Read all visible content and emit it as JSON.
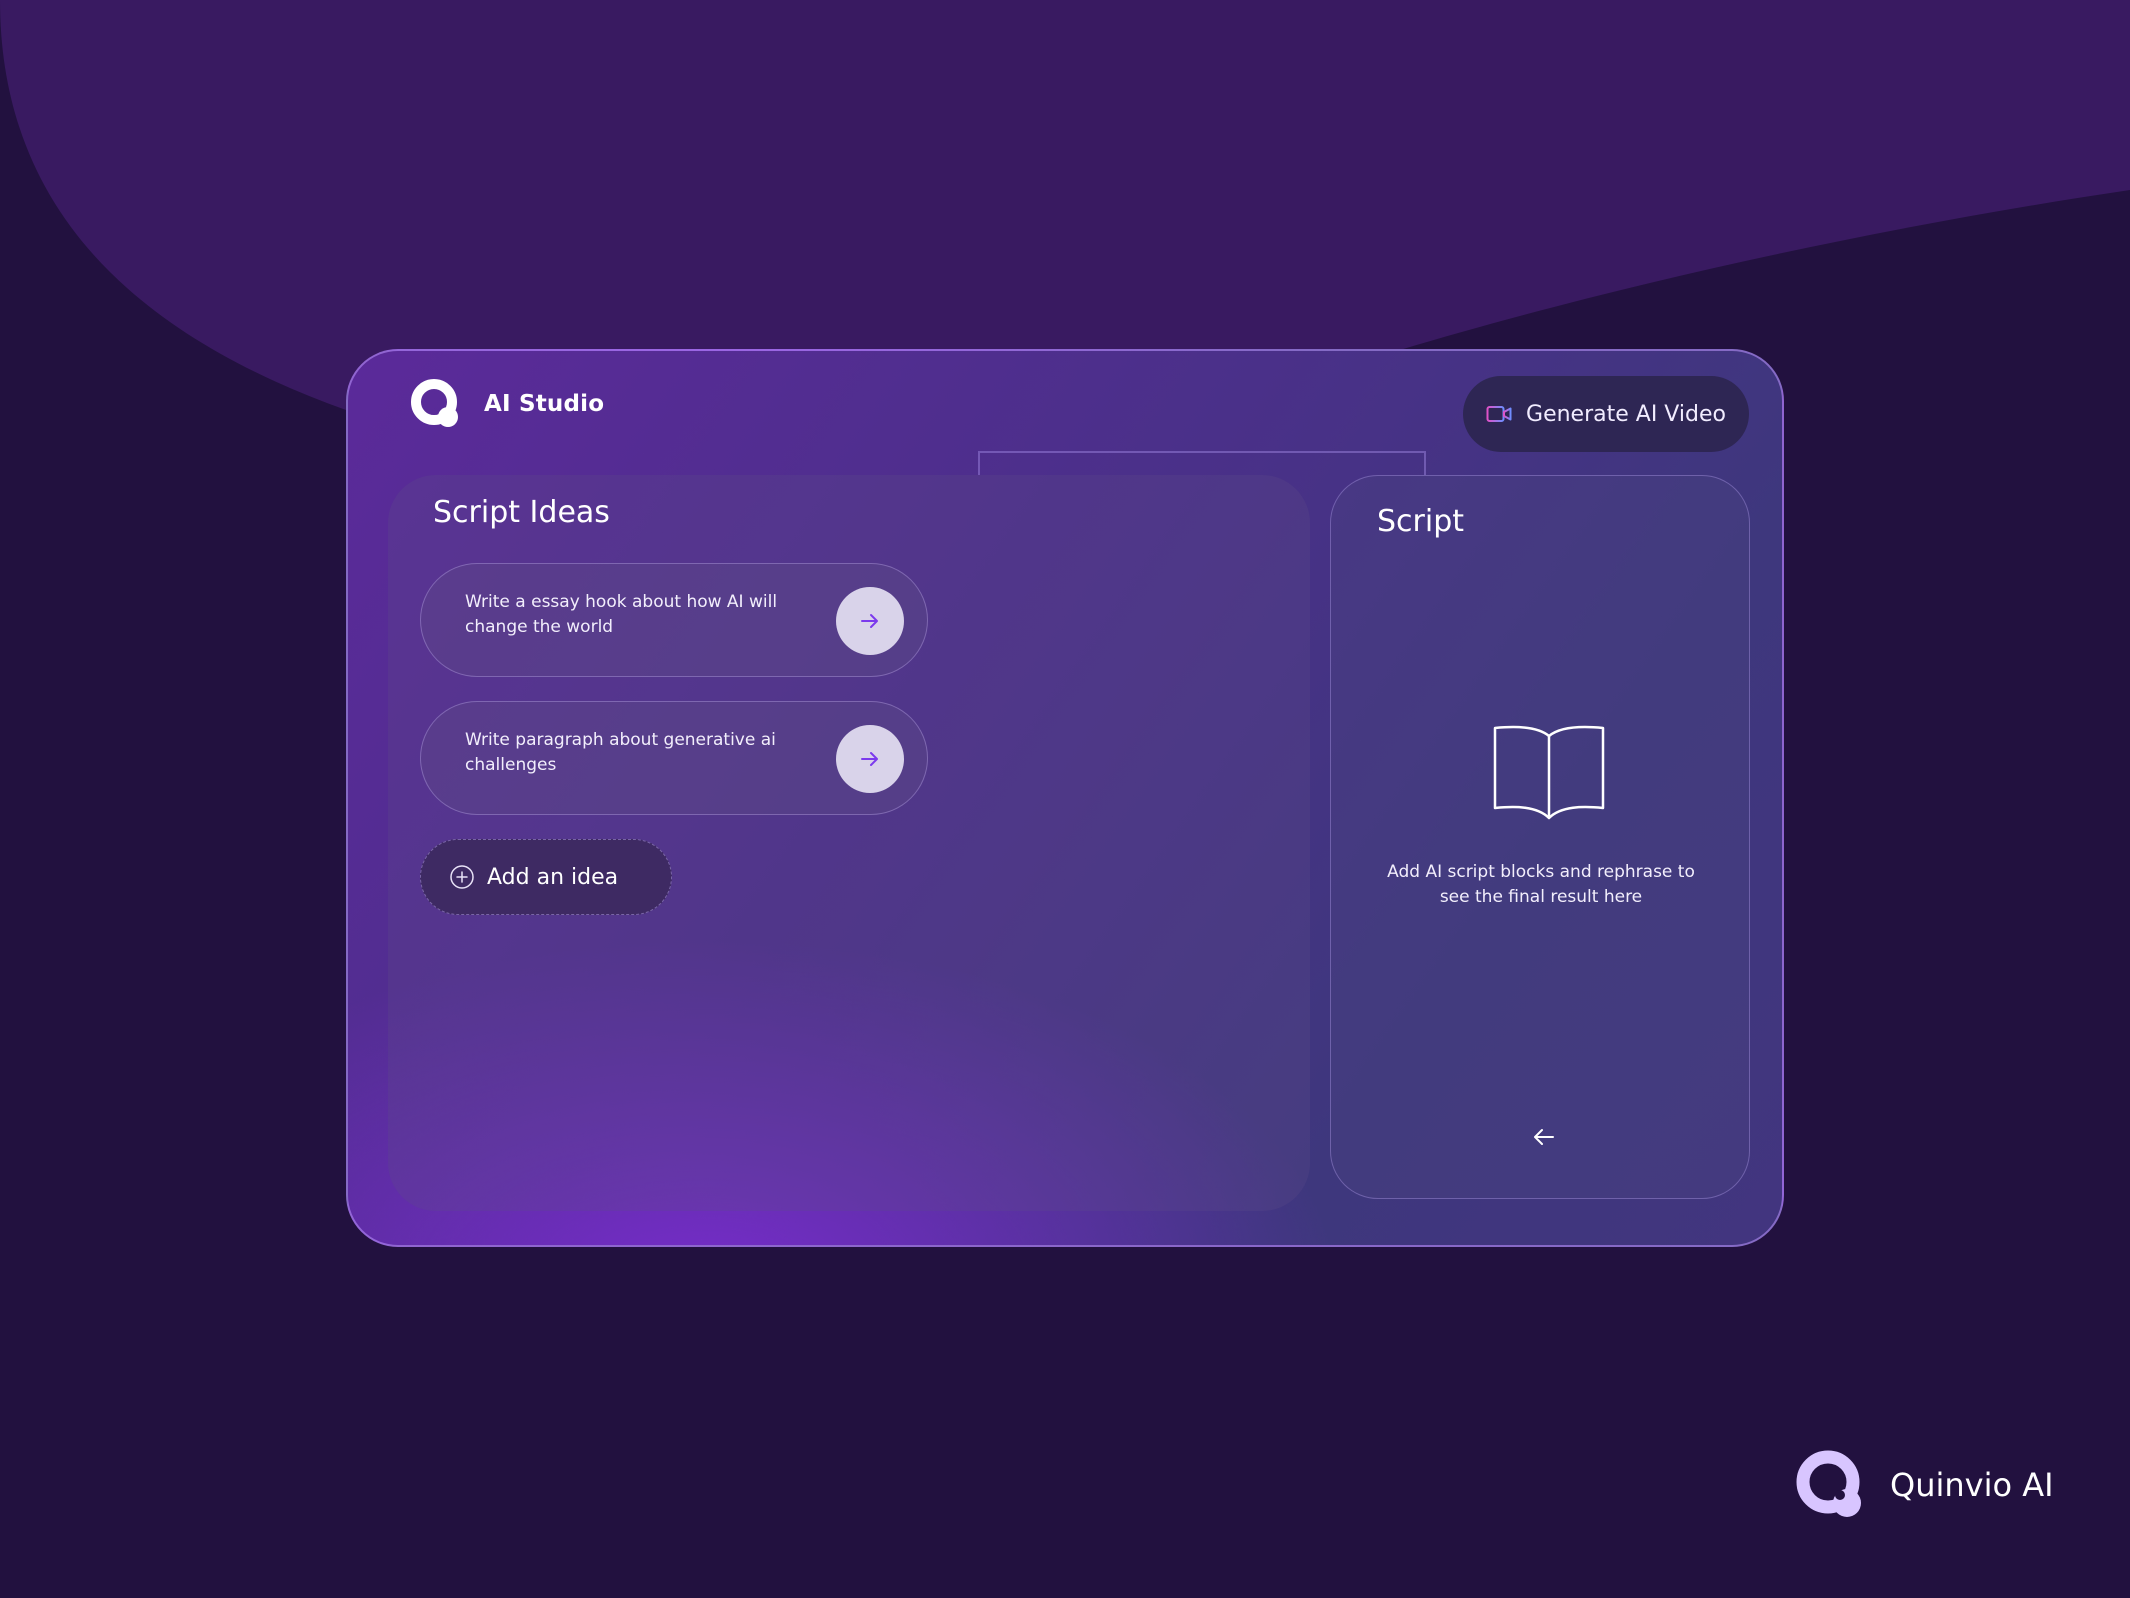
{
  "app": {
    "title": "AI Studio"
  },
  "header": {
    "generate_label": "Generate AI Video"
  },
  "ideas": {
    "title": "Script Ideas",
    "items": [
      {
        "text": "Write a essay hook about how AI will change the world"
      },
      {
        "text": "Write paragraph about generative ai challenges"
      }
    ],
    "add_label": "Add an idea"
  },
  "script": {
    "title": "Script",
    "empty_hint": "Add AI script blocks and rephrase to see the final result here"
  },
  "footer": {
    "brand": "Quinvio AI"
  },
  "icons": {
    "logo": "logo-icon",
    "generate": "video-camera-icon",
    "go": "arrow-right-icon",
    "add": "plus-circle-icon",
    "empty": "open-book-icon",
    "back": "arrow-left-icon"
  },
  "colors": {
    "background": "#22113f",
    "wave": "#391a61",
    "accent": "#7c3aed",
    "logo_light": "#d8c5ff"
  }
}
